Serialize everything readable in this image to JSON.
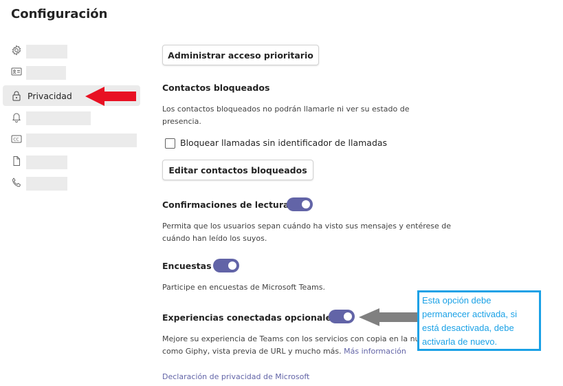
{
  "window": {
    "title": "Configuración"
  },
  "sidebar": {
    "items": [
      {
        "icon": "gear-icon"
      },
      {
        "icon": "contact-card-icon"
      },
      {
        "icon": "lock-icon",
        "label": "Privacidad",
        "selected": true
      },
      {
        "icon": "bell-icon"
      },
      {
        "icon": "closed-captions-icon"
      },
      {
        "icon": "file-icon"
      },
      {
        "icon": "phone-icon"
      }
    ]
  },
  "main": {
    "priority_access_button": "Administrar acceso prioritario",
    "blocked": {
      "heading": "Contactos bloqueados",
      "desc_line1": "Los contactos bloqueados no podrán llamarle ni ver su estado de",
      "desc_line2": "presencia.",
      "checkbox_label": "Bloquear llamadas sin identificador de llamadas",
      "checkbox_checked": false,
      "edit_button": "Editar contactos bloqueados"
    },
    "read_receipts": {
      "heading": "Confirmaciones de lectura",
      "enabled": true,
      "desc_line1": "Permita que los usuarios sepan cuándo ha visto sus mensajes y entérese de",
      "desc_line2": "cuándo han leído los suyos."
    },
    "surveys": {
      "heading": "Encuestas",
      "enabled": true,
      "desc": "Participe en encuestas de Microsoft Teams."
    },
    "optional_experiences": {
      "heading": "Experiencias conectadas opcionales",
      "enabled": true,
      "desc_line1": "Mejore su experiencia de Teams con los servicios con copia en la nube",
      "desc_line2": "como Giphy, vista previa de URL y mucho más.",
      "more_info_link": "Más información"
    },
    "privacy_statement_link": "Declaración de privacidad de Microsoft"
  },
  "annotation": {
    "callout_text": "Esta opción debe permanecer activada, si está desactivada, debe activarla de nuevo."
  },
  "colors": {
    "accent": "#6264a7",
    "red_arrow": "#e81123",
    "gray_arrow": "#808080",
    "callout": "#1aa1e6"
  }
}
